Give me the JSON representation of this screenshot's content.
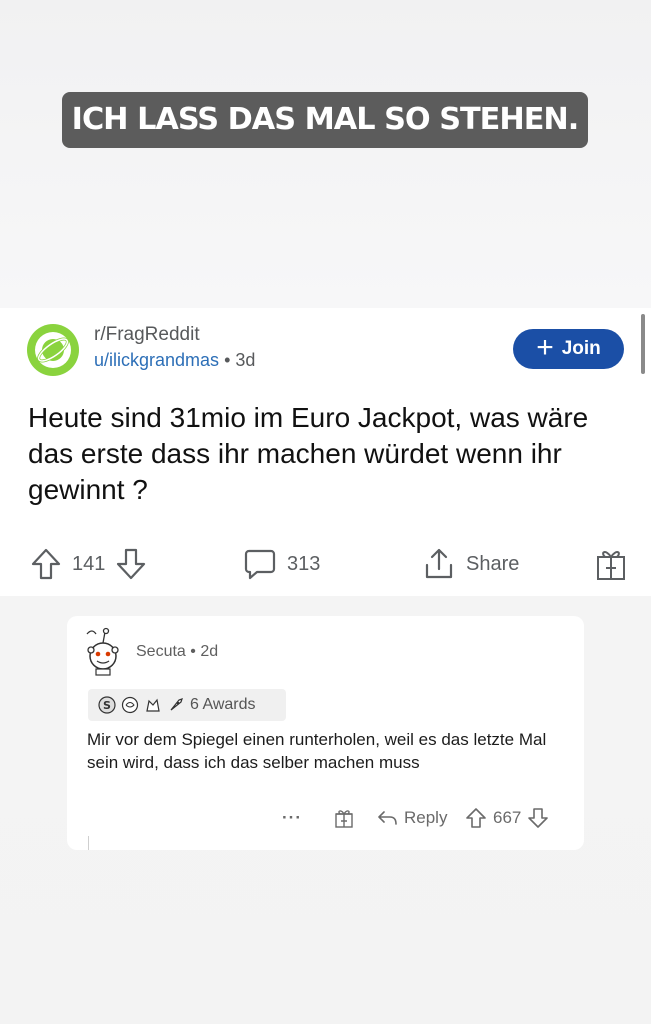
{
  "caption": "ICH LASS DAS MAL SO STEHEN.",
  "post": {
    "subreddit": "r/FragReddit",
    "author": "u/ilickgrandmas",
    "separator": "•",
    "age": "3d",
    "join_label": "Join",
    "title": "Heute sind 31mio im Euro Jackpot, was wäre das erste dass ihr machen würdet wenn ihr gewinnt ?",
    "upvotes": "141",
    "comments": "313",
    "share_label": "Share"
  },
  "comment": {
    "author": "Secuta",
    "separator": "•",
    "age": "2d",
    "awards_label": "6 Awards",
    "body": "Mir vor dem Spiegel einen runterholen, weil es das letzte Mal sein wird, dass ich das selber machen muss",
    "more": "···",
    "reply_label": "Reply",
    "votes": "667"
  },
  "colors": {
    "caption_bg": "#5c5c5c",
    "join_bg": "#1b4fa6",
    "subreddit_avatar": "#8ad33e",
    "author_link": "#2d6fb7"
  }
}
